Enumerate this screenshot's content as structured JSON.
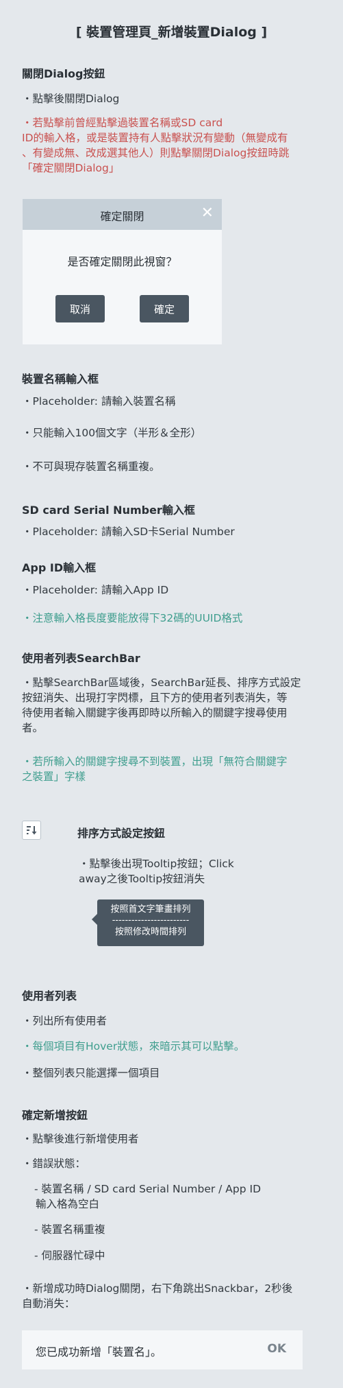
{
  "page_title": "[ 裝置管理頁_新增裝置Dialog ]",
  "close_section": {
    "heading": "關閉Dialog按鈕",
    "line1": "・點擊後關閉Dialog",
    "warn1": "・若點擊前曾經點擊過裝置名稱或SD card",
    "warn2": "ID的輸入格，或是裝置持有人點擊狀況有變動（無變成有",
    "warn3": "、有變成無、改成選其他人）則點擊關閉Dialog按鈕時跳",
    "warn4": "「確定關閉Dialog」"
  },
  "dialog": {
    "title": "確定關閉",
    "close": "✕",
    "message": "是否確定關閉此視窗？",
    "cancel": "取消",
    "confirm": "確定"
  },
  "name_section": {
    "heading": "裝置名稱輸入框",
    "line1": "・Placeholder: 請輸入裝置名稱",
    "line2": "・只能輸入100個文字（半形＆全形）",
    "line3": "・不可與現存裝置名稱重複。"
  },
  "sd_section": {
    "heading": "SD card Serial Number輸入框",
    "line1": "・Placeholder: 請輸入SD卡Serial Number"
  },
  "app_section": {
    "heading": "App ID輸入框",
    "line1": "・Placeholder: 請輸入App ID",
    "note": "・注意輸入格長度要能放得下32碼的UUID格式"
  },
  "search_section": {
    "heading": "使用者列表SearchBar",
    "l1": "・點擊SearchBar區域後，SearchBar延長、排序方式設定",
    "l2": "按鈕消失、出現打字閃標，且下方的使用者列表消失，等",
    "l3": "待使用者輸入關鍵字後再即時以所輸入的關鍵字搜尋使用",
    "l4": "者。",
    "n1": "・若所輸入的關鍵字搜尋不到裝置，出現「無符合關鍵字",
    "n2": "之裝置」字樣"
  },
  "sort_section": {
    "heading": "排序方式設定按鈕",
    "l1": "・點擊後出現Tooltip按鈕；Click",
    "l2": "away之後Tooltip按鈕消失",
    "tip1": "按照首文字筆畫排列",
    "tip_sep": "------------------------",
    "tip2": "按照修改時間排列"
  },
  "list_section": {
    "heading": "使用者列表",
    "line1": "・列出所有使用者",
    "line2": "・每個項目有Hover狀態，來暗示其可以點擊。",
    "line3": "・整個列表只能選擇一個項目"
  },
  "add_section": {
    "heading": "確定新增按鈕",
    "line1": "・點擊後進行新增使用者",
    "line2": "・錯誤狀態：",
    "err1a": "- 裝置名稱 / SD card Serial Number / App ID",
    "err1b": "輸入格為空白",
    "err2": "- 裝置名稱重複",
    "err3": "- 伺服器忙碌中",
    "s1": "・新增成功時Dialog關閉，右下角跳出Snackbar，2秒後",
    "s2": "自動消失："
  },
  "snackbar": {
    "message": "您已成功新增「裝置名」。",
    "ok": "OK"
  },
  "icons": {
    "sort": "sort-icon"
  }
}
